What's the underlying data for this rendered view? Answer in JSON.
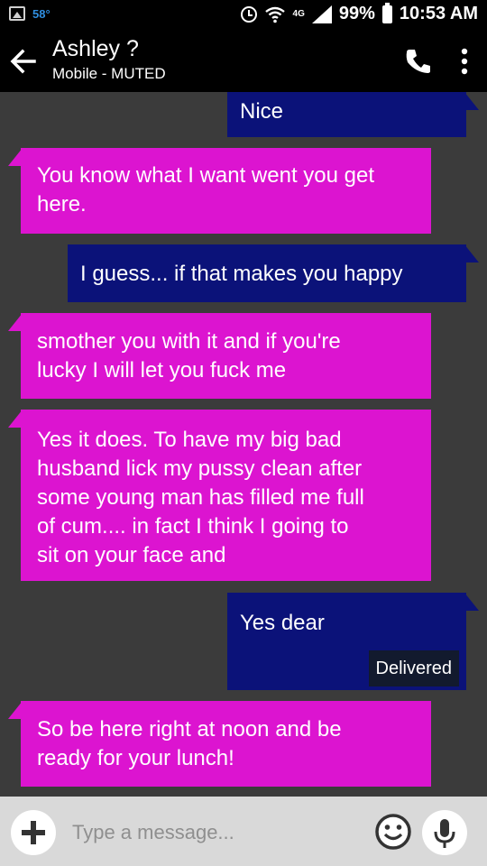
{
  "status_bar": {
    "temperature": "58°",
    "network": "4G",
    "battery": "99%",
    "time": "10:53 AM",
    "icons": [
      "image-icon",
      "alarm-icon",
      "wifi-icon",
      "signal-icon",
      "battery-icon"
    ]
  },
  "header": {
    "contact_name": "Ashley ?",
    "subtitle": "Mobile - MUTED"
  },
  "messages": [
    {
      "direction": "out",
      "lines": [
        "Nice"
      ]
    },
    {
      "direction": "in",
      "lines": [
        "You know what I want went you get",
        "here."
      ]
    },
    {
      "direction": "out",
      "lines": [
        "I guess... if that makes you happy"
      ]
    },
    {
      "direction": "in",
      "lines": [
        "smother you with it and if you're",
        "lucky I will let you fuck me"
      ]
    },
    {
      "direction": "in",
      "lines": [
        "Yes it does. To have my big bad",
        "husband lick my pussy clean after",
        "some young man has filled me full",
        "of cum.... in fact I think I going to",
        "sit on your face and"
      ]
    },
    {
      "direction": "out",
      "lines": [
        "Yes dear"
      ],
      "status": "Delivered"
    },
    {
      "direction": "in",
      "lines": [
        "So be here right at noon and be",
        "ready for your lunch!"
      ]
    }
  ],
  "compose": {
    "placeholder": "Type a message..."
  },
  "colors": {
    "incoming_bubble": "#dc14d0",
    "outgoing_bubble": "#0b1279",
    "background": "#3b3b3b",
    "header": "#000000",
    "temperature_accent": "#2f8ee0"
  }
}
